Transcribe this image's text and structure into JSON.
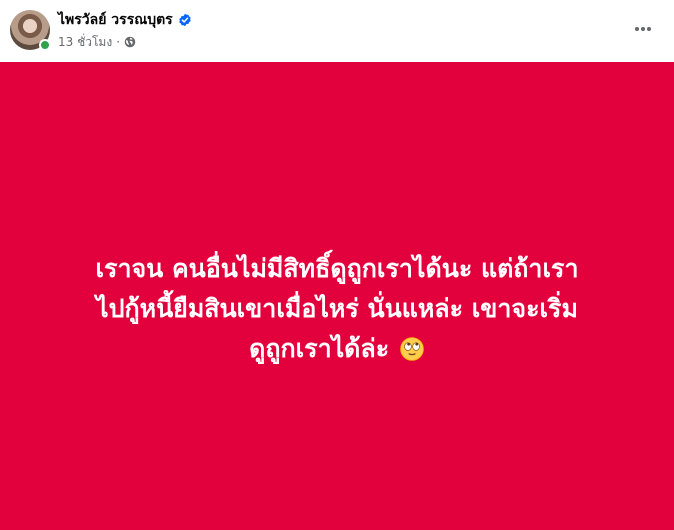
{
  "author": {
    "name": "ไพรวัลย์ วรรณบุตร",
    "verified": true,
    "online": true
  },
  "meta": {
    "time": "13 ชั่วโมง",
    "separator": "·",
    "privacy_icon": "globe-icon"
  },
  "header": {
    "more_icon": "more-horizontal-icon"
  },
  "status": {
    "background": "#e2003d",
    "text_color": "#ffffff",
    "line1": "เราจน คนอื่นไม่มีสิทธิ์ดูถูกเราได้นะ แต่ถ้าเรา",
    "line2": "ไปกู้หนี้ยืมสินเขาเมื่อไหร่ นั่นแหล่ะ เขาจะเริ่ม",
    "line3": "ดูถูกเราได้ล่ะ",
    "emoji": "face-with-rolling-eyes"
  },
  "colors": {
    "name": "#050505",
    "meta": "#65676b",
    "verified": "#0866ff",
    "online": "#31a24c"
  }
}
